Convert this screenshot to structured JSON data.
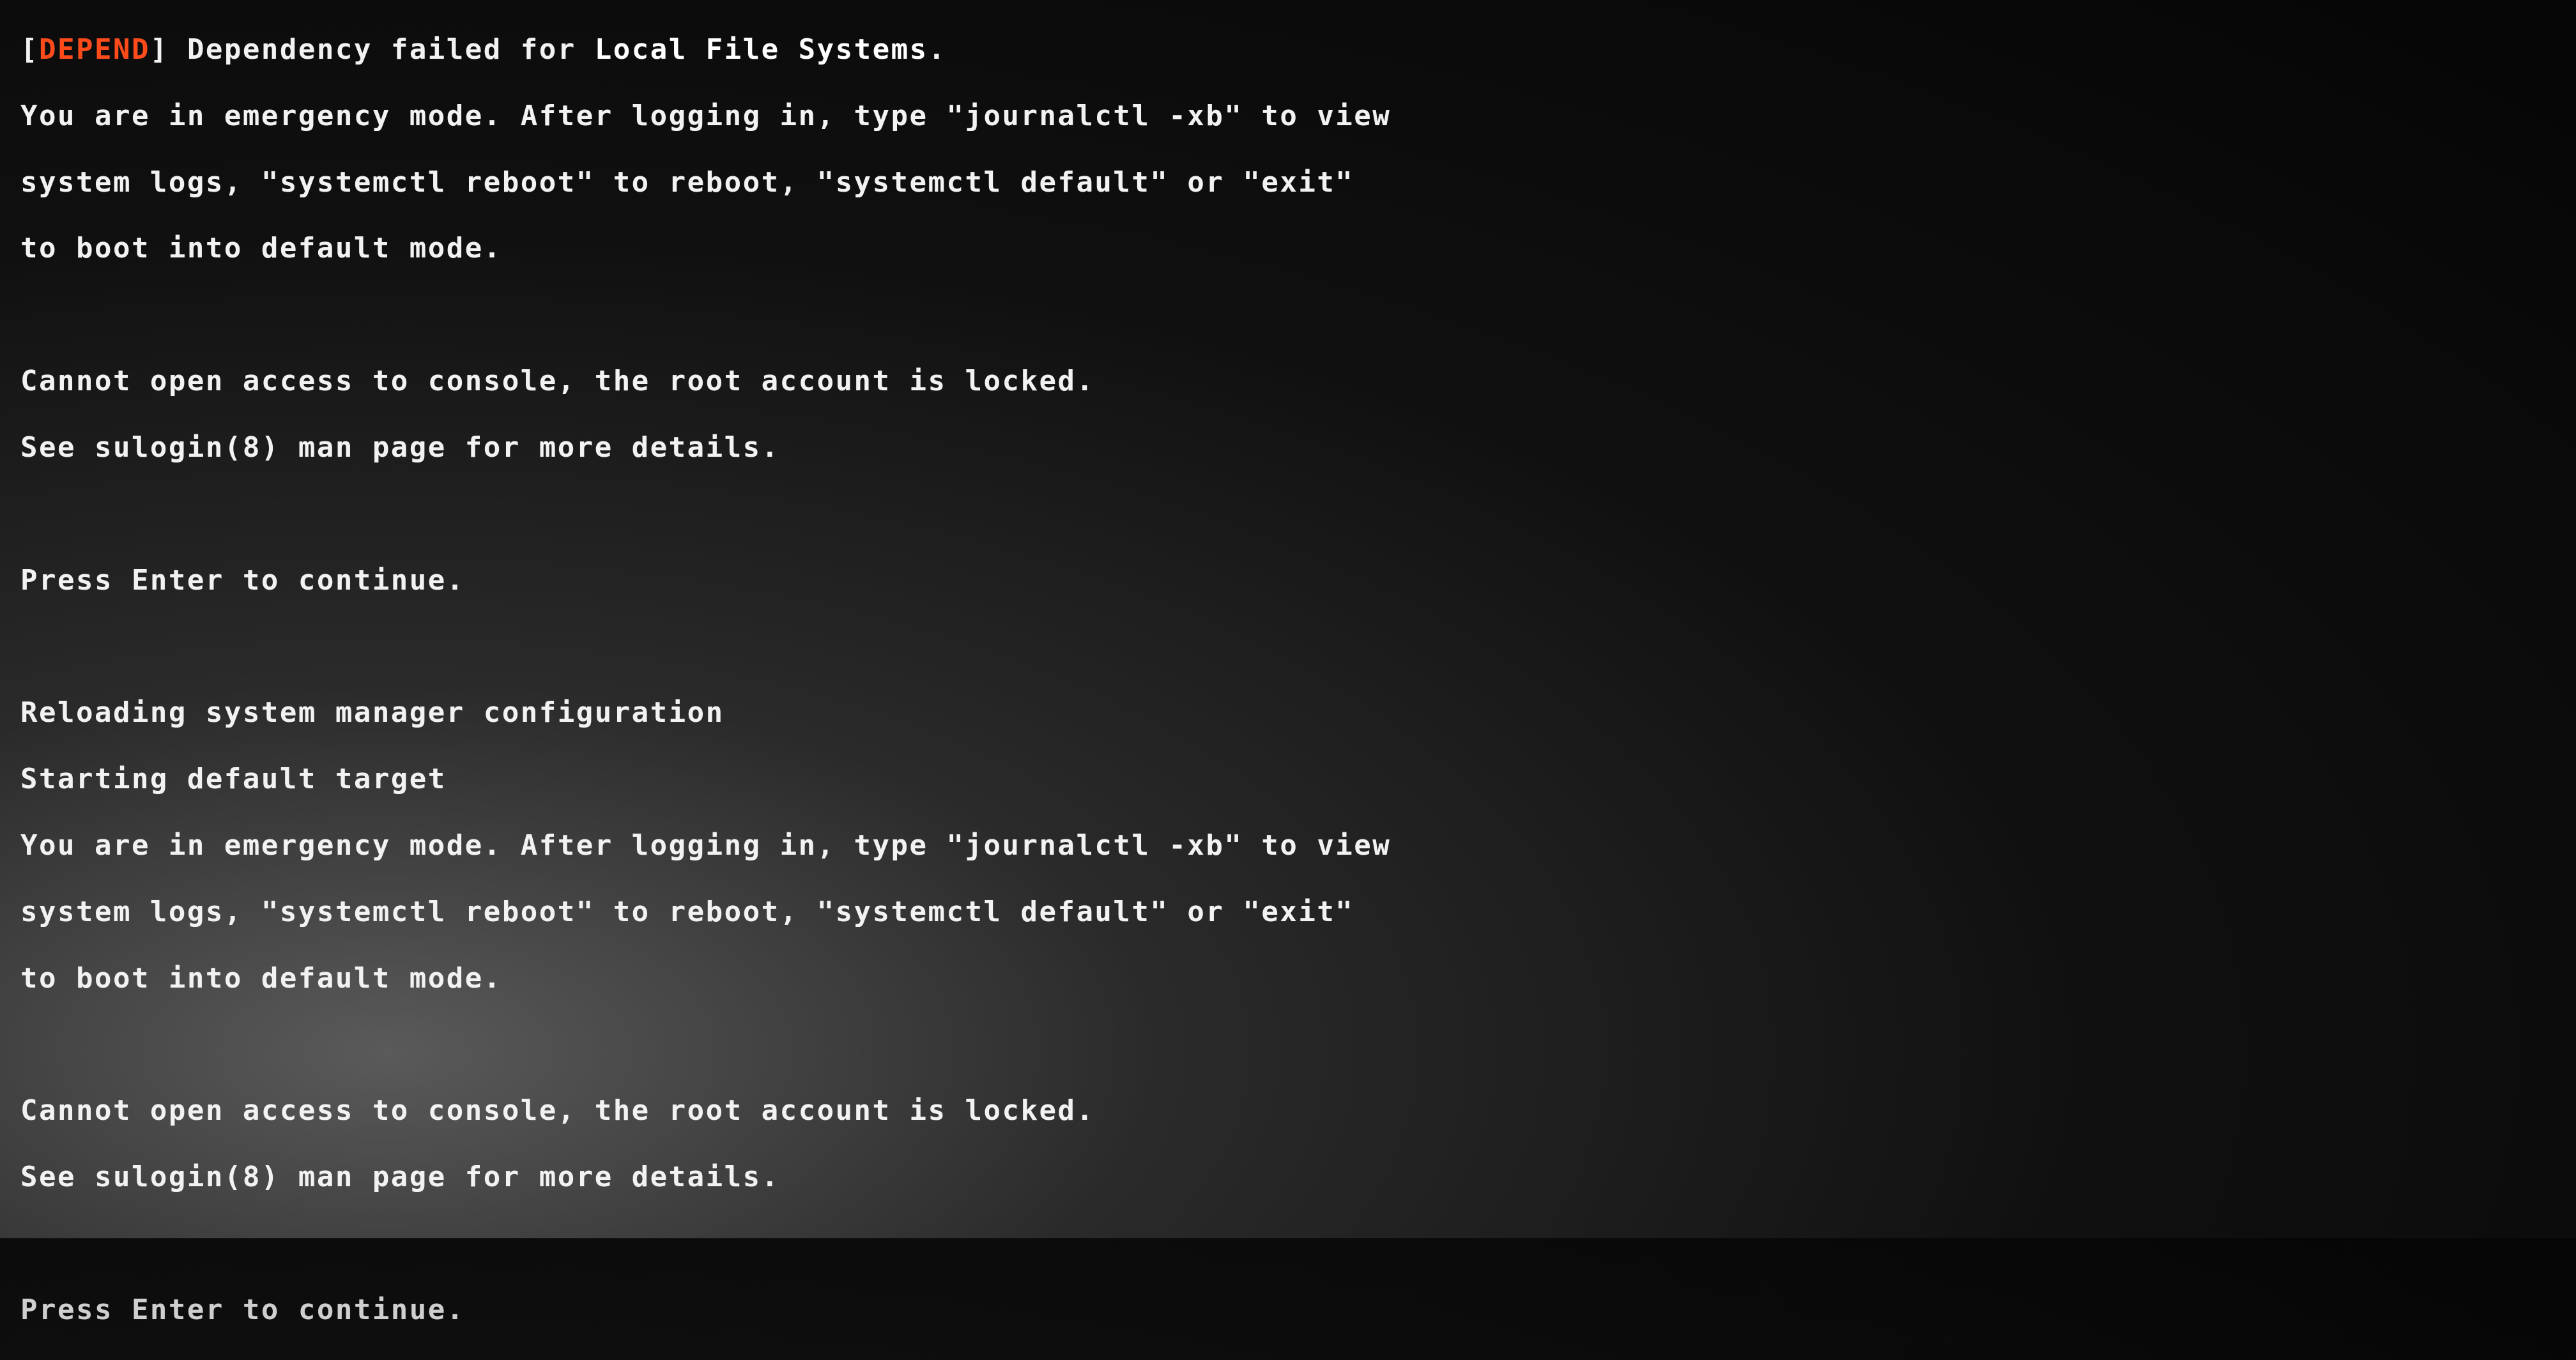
{
  "colors": {
    "foreground": "#f2f2f2",
    "background": "#101010",
    "error_tag": "#ff4a1a",
    "bold": "#ffffff"
  },
  "lines": {
    "l0_bracket_open": "[",
    "l0_tag": "DEPEND",
    "l0_bracket_close": "] ",
    "l0_msg_a": "Dependency failed for ",
    "l0_msg_b": "Local File Systems",
    "l0_msg_c": ".",
    "l1": "You are in emergency mode. After logging in, type \"journalctl -xb\" to view",
    "l2": "system logs, \"systemctl reboot\" to reboot, \"systemctl default\" or \"exit\"",
    "l3": "to boot into default mode.",
    "l4": "Cannot open access to console, the root account is locked.",
    "l5": "See sulogin(8) man page for more details.",
    "l6": "Press Enter to continue.",
    "l7": "Reloading system manager configuration",
    "l8": "Starting default target",
    "l9": "You are in emergency mode. After logging in, type \"journalctl -xb\" to view",
    "l10": "system logs, \"systemctl reboot\" to reboot, \"systemctl default\" or \"exit\"",
    "l11": "to boot into default mode.",
    "l12": "Cannot open access to console, the root account is locked.",
    "l13": "See sulogin(8) man page for more details.",
    "l14": "Press Enter to continue."
  }
}
